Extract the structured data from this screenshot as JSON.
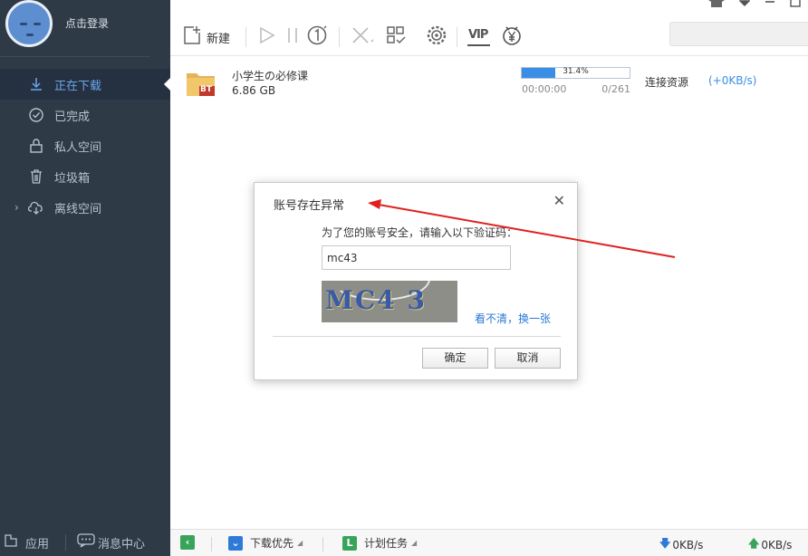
{
  "user": {
    "login_label": "点击登录"
  },
  "sidebar": {
    "items": [
      {
        "label": "正在下载",
        "icon": "download-arrow-icon"
      },
      {
        "label": "已完成",
        "icon": "check-circle-icon"
      },
      {
        "label": "私人空间",
        "icon": "lock-icon"
      },
      {
        "label": "垃圾箱",
        "icon": "trash-icon"
      },
      {
        "label": "离线空间",
        "icon": "cloud-download-icon"
      }
    ],
    "bottom": {
      "apps_label": "应用",
      "messages_label": "消息中心"
    }
  },
  "toolbar": {
    "new_label": "新建",
    "vip_label": "VIP"
  },
  "downloads": [
    {
      "name": "小学生の必修课",
      "size": "6.86 GB",
      "badge": "BT",
      "progress_text": "31.4%",
      "progress": 0.314,
      "elapsed": "00:00:00",
      "sources": "0/261",
      "status": "连接资源",
      "speed": "(+0KB/s)"
    }
  ],
  "dialog": {
    "title": "账号存在异常",
    "prompt": "为了您的账号安全，请输入以下验证码：",
    "input_value": "mc43",
    "captcha_text": "MC4 3",
    "refresh_label": "看不清，换一张",
    "ok_label": "确定",
    "cancel_label": "取消"
  },
  "statusbar": {
    "priority_label": "下载优先",
    "schedule_label": "计划任务",
    "down_speed": "0KB/s",
    "up_speed": "0KB/s"
  },
  "colors": {
    "accent": "#3a8ee6",
    "sidebar_bg": "#2f3a47",
    "annotation": "#e02020"
  }
}
